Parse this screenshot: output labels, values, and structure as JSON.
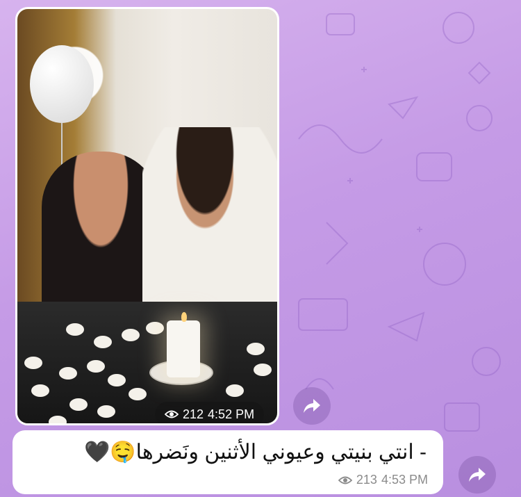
{
  "photo_message": {
    "views": "212",
    "time": "4:52 PM"
  },
  "text_message": {
    "text": "- انتي بنيتي وعيوني الأثنين ونَضرها🤤🖤",
    "views": "213",
    "time": "4:53 PM"
  },
  "icons": {
    "views": "eye-icon",
    "share": "share-arrow-icon"
  },
  "colors": {
    "background": "#c59be6",
    "bubble": "#ffffff",
    "meta_overlay": "#141414",
    "meta_text": "#8b8b8b"
  }
}
